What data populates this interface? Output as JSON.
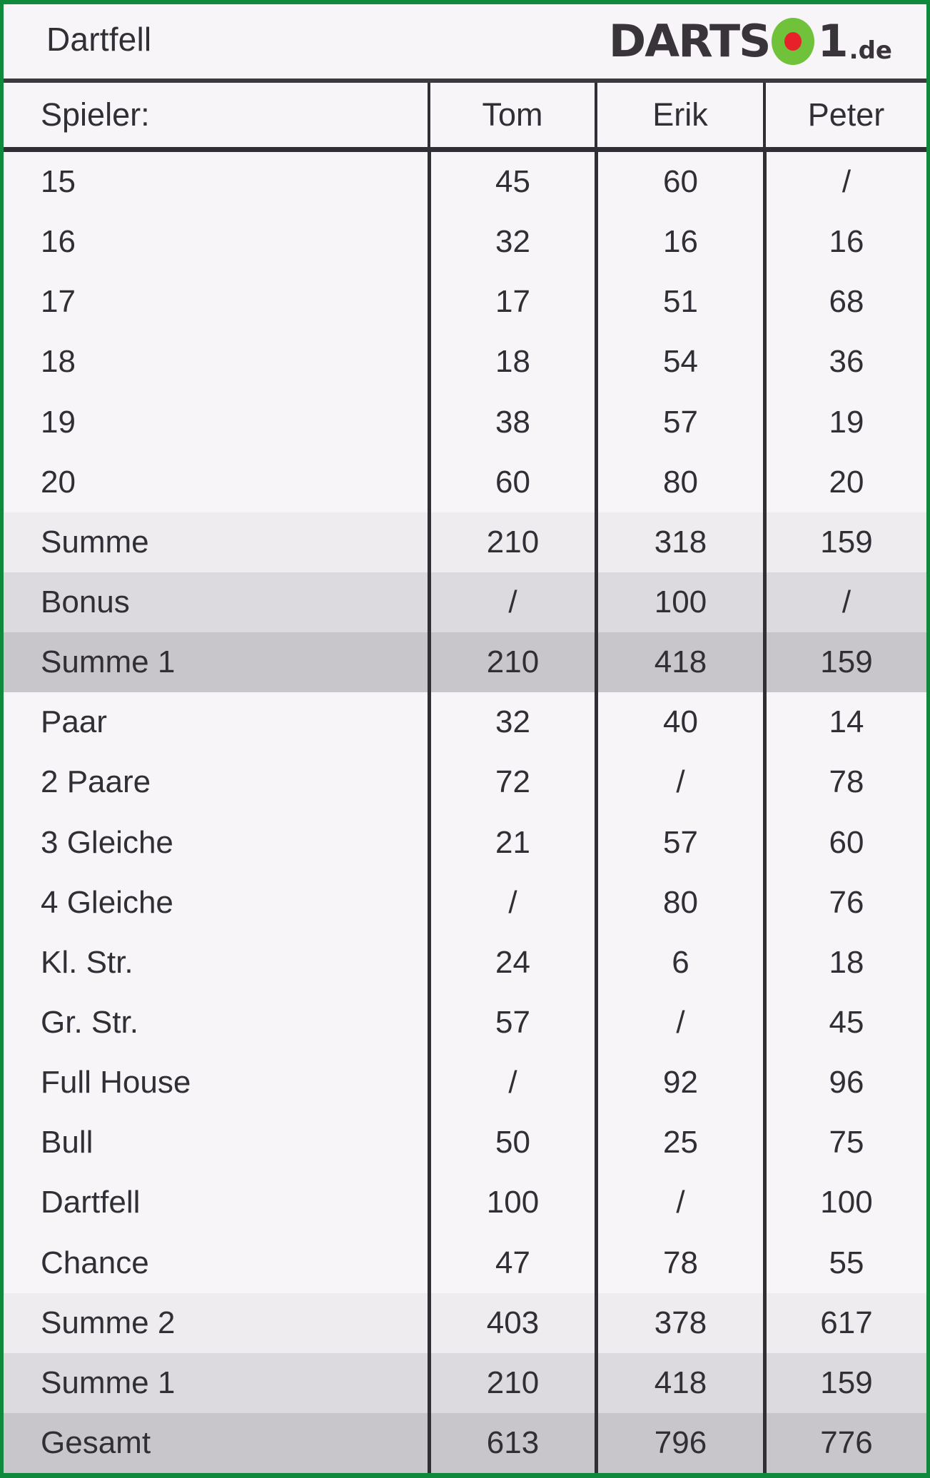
{
  "header": {
    "title": "Dartfell",
    "logo": {
      "word": "DARTS",
      "bull_icon": "dartboard-bullseye-icon",
      "one": "1",
      "tld": ".de",
      "green": "#6fc23a",
      "red": "#e8202a",
      "dark": "#38343a"
    }
  },
  "table": {
    "columns": [
      "Spieler:",
      "Tom",
      "Erik",
      "Peter"
    ],
    "rows": [
      {
        "label": "15",
        "values": [
          "45",
          "60",
          "/"
        ],
        "shade": 0
      },
      {
        "label": "16",
        "values": [
          "32",
          "16",
          "16"
        ],
        "shade": 0
      },
      {
        "label": "17",
        "values": [
          "17",
          "51",
          "68"
        ],
        "shade": 0
      },
      {
        "label": "18",
        "values": [
          "18",
          "54",
          "36"
        ],
        "shade": 0
      },
      {
        "label": "19",
        "values": [
          "38",
          "57",
          "19"
        ],
        "shade": 0
      },
      {
        "label": "20",
        "values": [
          "60",
          "80",
          "20"
        ],
        "shade": 0
      },
      {
        "label": "Summe",
        "values": [
          "210",
          "318",
          "159"
        ],
        "shade": 1
      },
      {
        "label": "Bonus",
        "values": [
          "/",
          "100",
          "/"
        ],
        "shade": 2
      },
      {
        "label": "Summe 1",
        "values": [
          "210",
          "418",
          "159"
        ],
        "shade": 3
      },
      {
        "label": "Paar",
        "values": [
          "32",
          "40",
          "14"
        ],
        "shade": 0
      },
      {
        "label": "2 Paare",
        "values": [
          "72",
          "/",
          "78"
        ],
        "shade": 0
      },
      {
        "label": "3 Gleiche",
        "values": [
          "21",
          "57",
          "60"
        ],
        "shade": 0
      },
      {
        "label": "4 Gleiche",
        "values": [
          "/",
          "80",
          "76"
        ],
        "shade": 0
      },
      {
        "label": "Kl. Str.",
        "values": [
          "24",
          "6",
          "18"
        ],
        "shade": 0
      },
      {
        "label": "Gr. Str.",
        "values": [
          "57",
          "/",
          "45"
        ],
        "shade": 0
      },
      {
        "label": "Full House",
        "values": [
          "/",
          "92",
          "96"
        ],
        "shade": 0
      },
      {
        "label": "Bull",
        "values": [
          "50",
          "25",
          "75"
        ],
        "shade": 0
      },
      {
        "label": "Dartfell",
        "values": [
          "100",
          "/",
          "100"
        ],
        "shade": 0
      },
      {
        "label": "Chance",
        "values": [
          "47",
          "78",
          "55"
        ],
        "shade": 0
      },
      {
        "label": "Summe 2",
        "values": [
          "403",
          "378",
          "617"
        ],
        "shade": 1
      },
      {
        "label": "Summe 1",
        "values": [
          "210",
          "418",
          "159"
        ],
        "shade": 2
      },
      {
        "label": "Gesamt",
        "values": [
          "613",
          "796",
          "776"
        ],
        "shade": 3
      }
    ]
  },
  "colors": {
    "border_green": "#0f8a3c",
    "rule_dark": "#2f2f35",
    "paper": "#f7f5f8",
    "shade_1": "#eeecef",
    "shade_2": "#dcdade",
    "shade_3": "#c8c6cb"
  }
}
